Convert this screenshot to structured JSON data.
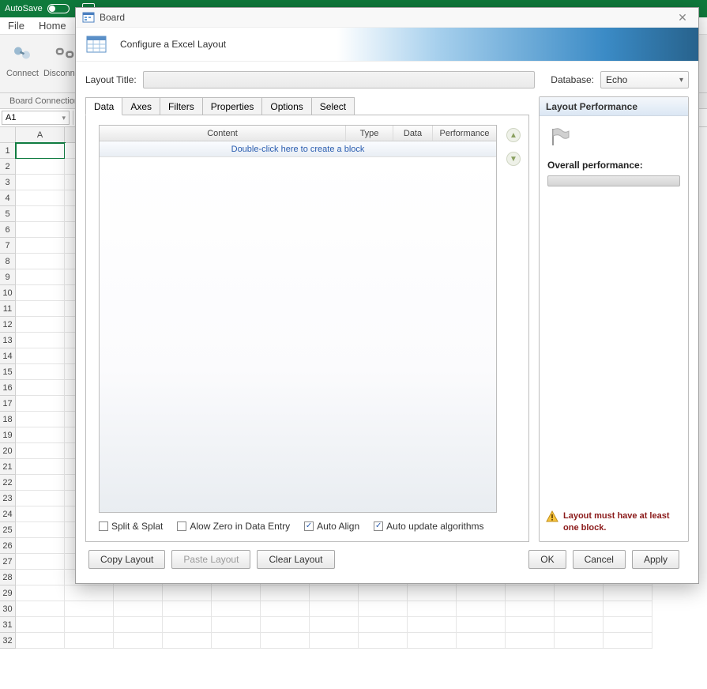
{
  "excel": {
    "autosave_label": "AutoSave",
    "menu_file": "File",
    "menu_home": "Home",
    "ribbon_connect": "Connect",
    "ribbon_disconnect": "Disconnect",
    "group_label": "Board Connection",
    "namebox": "A1",
    "col_a": "A"
  },
  "rows": [
    "1",
    "2",
    "3",
    "4",
    "5",
    "6",
    "7",
    "8",
    "9",
    "10",
    "11",
    "12",
    "13",
    "14",
    "15",
    "16",
    "17",
    "18",
    "19",
    "20",
    "21",
    "22",
    "23",
    "24",
    "25",
    "26",
    "27",
    "28",
    "29",
    "30",
    "31",
    "32"
  ],
  "dlg": {
    "window_title": "Board",
    "banner_text": "Configure a Excel Layout",
    "layout_title_label": "Layout Title:",
    "database_label": "Database:",
    "database_value": "Echo",
    "tabs": {
      "data": "Data",
      "axes": "Axes",
      "filters": "Filters",
      "properties": "Properties",
      "options": "Options",
      "select": "Select"
    },
    "table_headers": {
      "content": "Content",
      "type": "Type",
      "data": "Data",
      "performance": "Performance"
    },
    "placeholder_row": "Double-click here to create a block",
    "checks": {
      "split": "Split & Splat",
      "zero": "Alow Zero in Data Entry",
      "align": "Auto Align",
      "algos": "Auto update algorithms"
    },
    "perf_header": "Layout Performance",
    "overall_label": "Overall performance:",
    "warning_text": "Layout must have at least one block.",
    "footer": {
      "copy": "Copy Layout",
      "paste": "Paste Layout",
      "clear": "Clear Layout",
      "ok": "OK",
      "cancel": "Cancel",
      "apply": "Apply"
    }
  }
}
